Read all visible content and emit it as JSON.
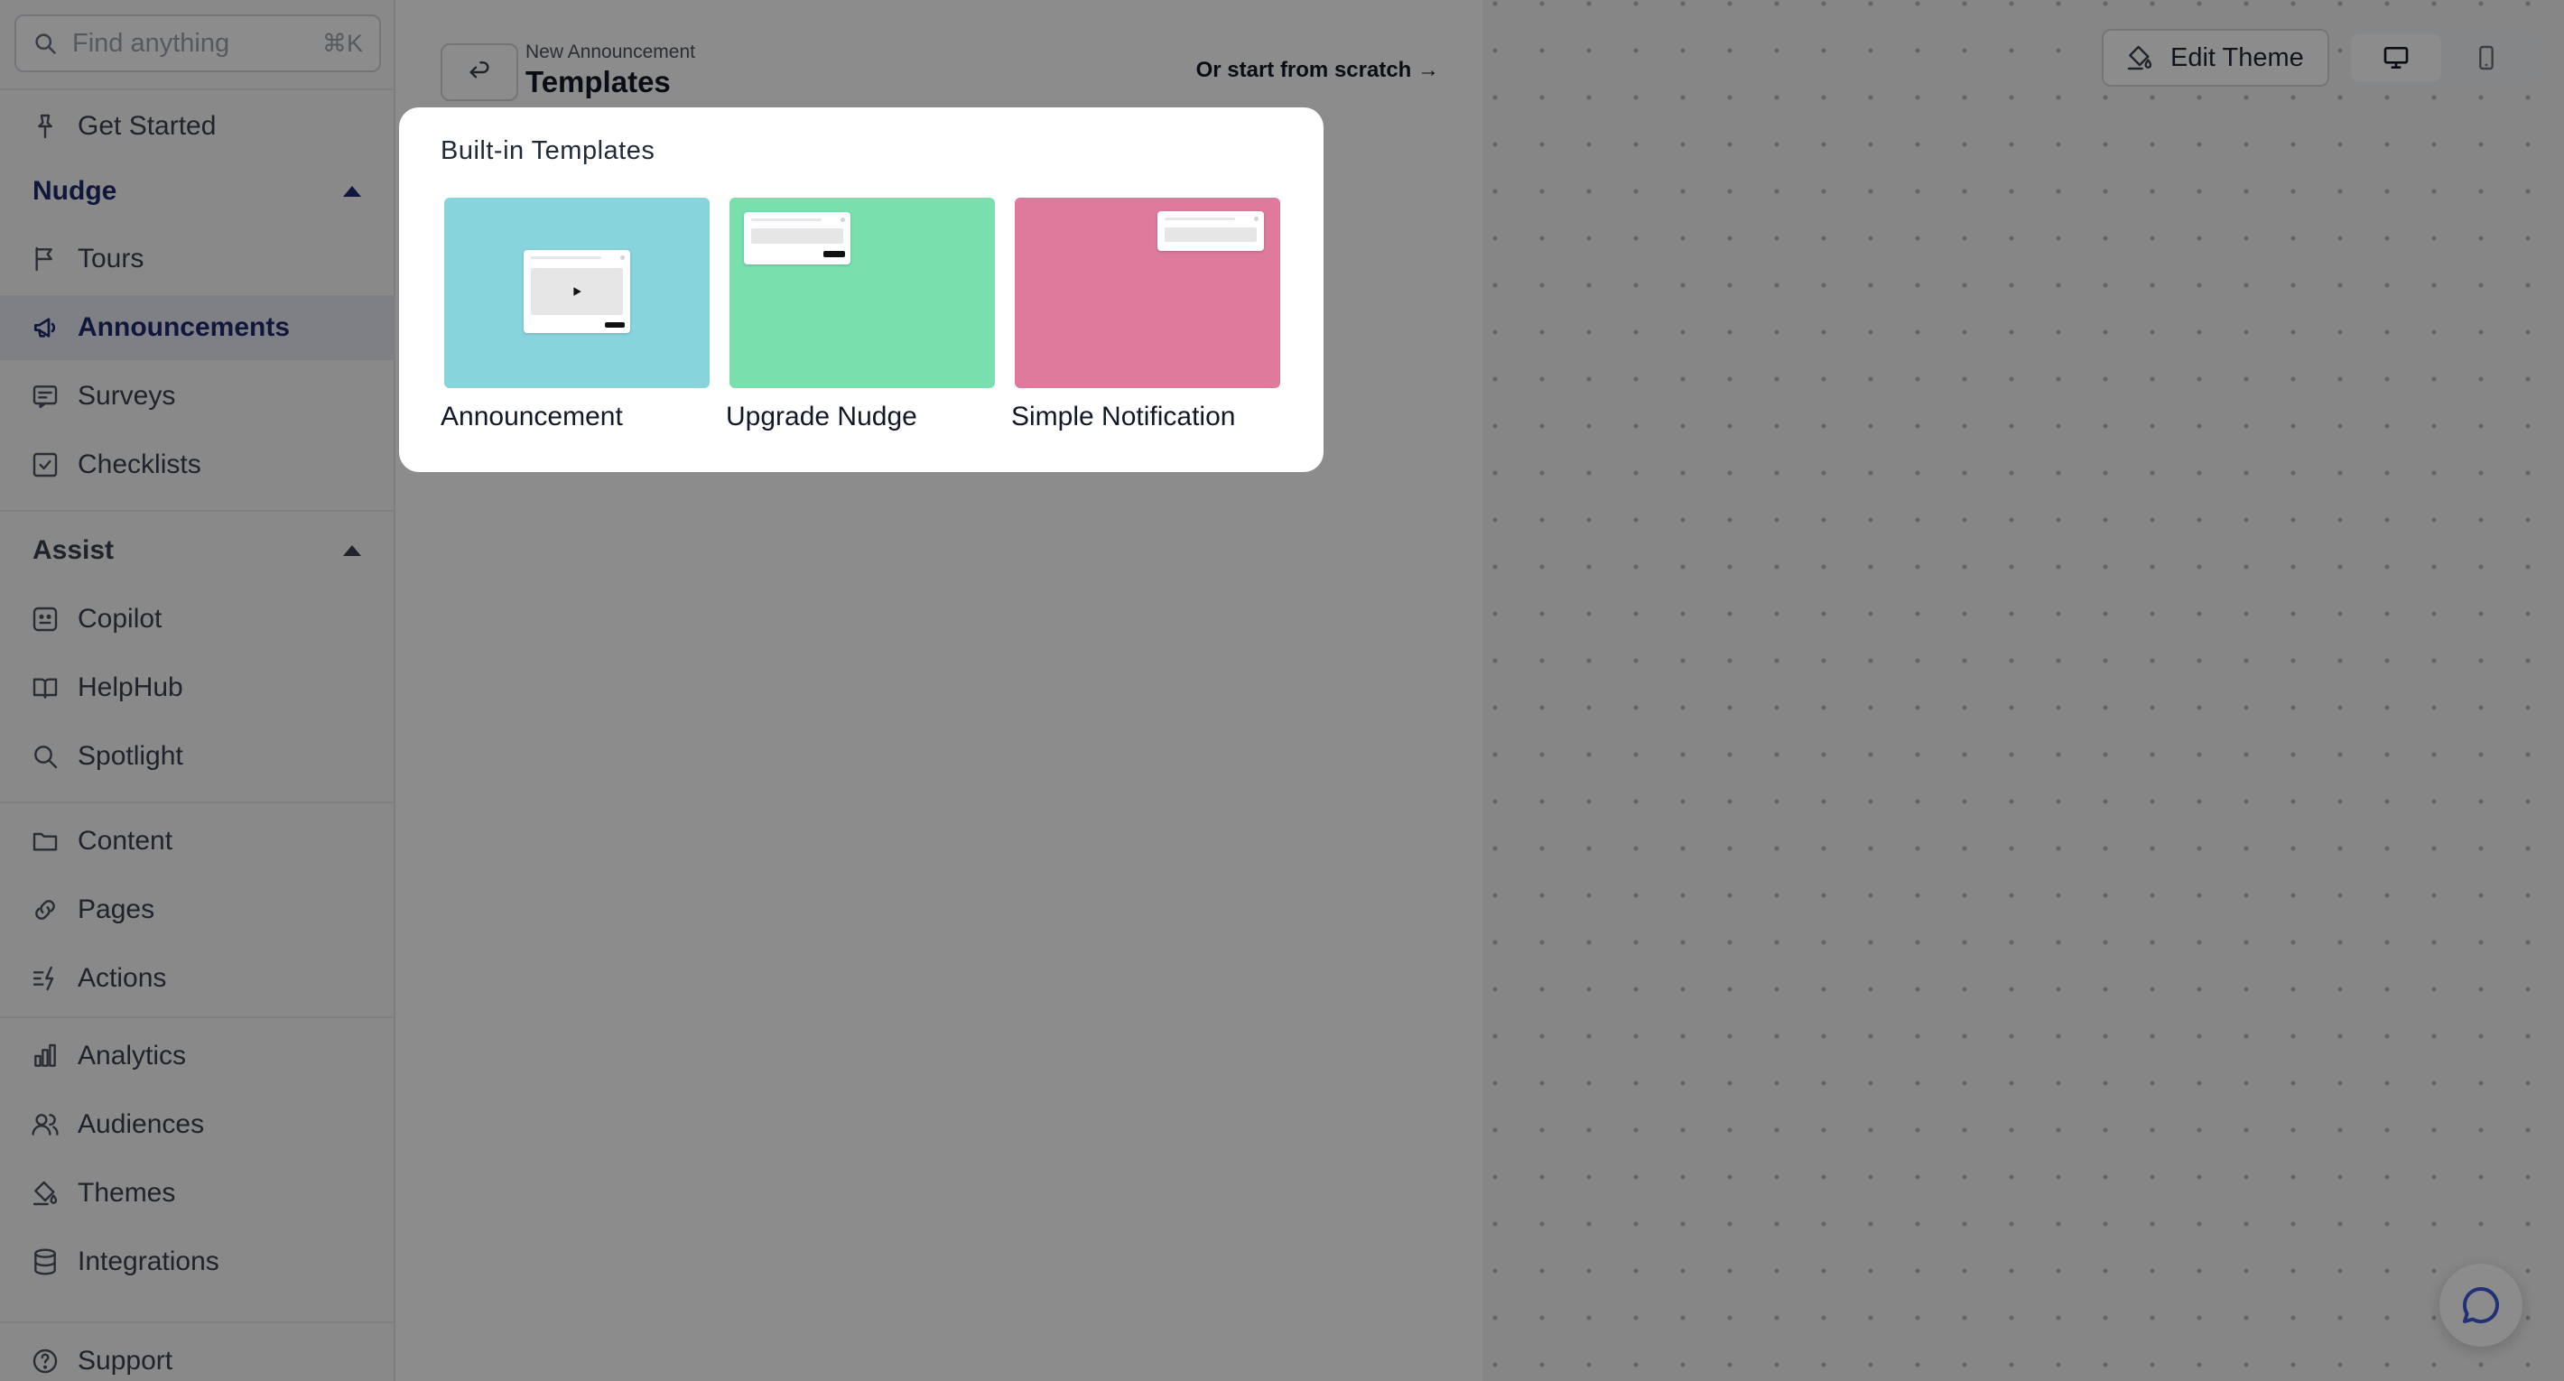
{
  "search": {
    "placeholder": "Find anything",
    "shortcut": "⌘K"
  },
  "sidebar": {
    "get_started": "Get Started",
    "nudge_header": "Nudge",
    "tours": "Tours",
    "announcements": "Announcements",
    "surveys": "Surveys",
    "checklists": "Checklists",
    "assist_header": "Assist",
    "copilot": "Copilot",
    "helphub": "HelpHub",
    "spotlight": "Spotlight",
    "content": "Content",
    "pages": "Pages",
    "actions": "Actions",
    "analytics": "Analytics",
    "audiences": "Audiences",
    "themes": "Themes",
    "integrations": "Integrations",
    "support": "Support"
  },
  "editor": {
    "breadcrumb_sub": "New Announcement",
    "title": "Templates",
    "scratch_link": "Or start from scratch →"
  },
  "preview": {
    "edit_theme_label": "Edit Theme",
    "device_selected": "desktop"
  },
  "modal": {
    "title": "Built-in Templates",
    "templates": [
      {
        "name": "Announcement",
        "color": "#87d4dd"
      },
      {
        "name": "Upgrade Nudge",
        "color": "#78dfad"
      },
      {
        "name": "Simple Notification",
        "color": "#df7a9c"
      }
    ]
  },
  "colors": {
    "accent": "#1e2a6e",
    "active_bg": "#e8eaf3",
    "chat_icon": "#3b5bd6"
  }
}
